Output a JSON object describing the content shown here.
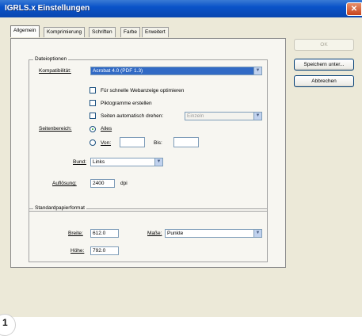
{
  "window": {
    "title": "IGRLS.x  Einstellungen",
    "close_glyph": "✕"
  },
  "tabs": [
    "Allgemein",
    "Komprimierung",
    "Schriften",
    "Farbe",
    "Erweitert"
  ],
  "dateioptionen": {
    "title": "Dateioptionen",
    "kompat_label": "Kompatibilität:",
    "kompat_value": "Acrobat 4.0 (PDF 1.3)",
    "check_web": "Für schnelle Webanzeige optimieren",
    "check_piktogramme": "Piktogramme erstellen",
    "check_seiten": "Seiten automatisch drehen:",
    "seiten_value": "Einzeln",
    "seitenbereich_label": "Seitenbereich:",
    "radio_alles": "Alles",
    "radio_von": "Von:",
    "bis_label": "Bis:",
    "bund_label": "Bund:",
    "bund_value": "Links",
    "aufloesung_label": "Auflösung:",
    "aufloesung_value": "2400",
    "aufloesung_unit": "dpi"
  },
  "standard": {
    "title": "Standardpapierformat",
    "breite_label": "Breite:",
    "breite_value": "612.0",
    "hoehe_label": "Höhe:",
    "hoehe_value": "792.0",
    "masse_label": "Maße:",
    "masse_value": "Punkte"
  },
  "buttons": {
    "ok": "OK",
    "speichern": "Speichern unter...",
    "abbrechen": "Abbrechen"
  },
  "footer_number": "1",
  "icons": {
    "dropdown": "▼"
  }
}
